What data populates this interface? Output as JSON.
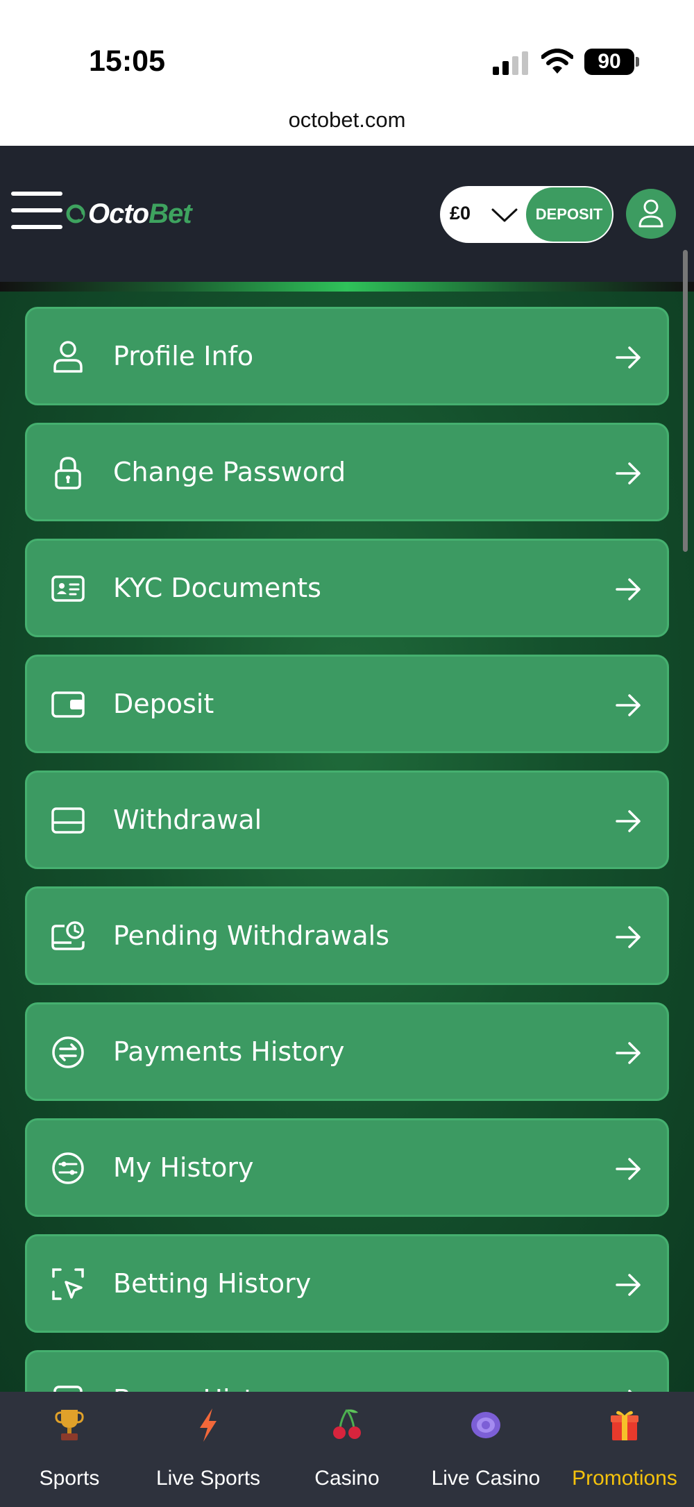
{
  "status_bar": {
    "time": "15:05",
    "battery": "90"
  },
  "browser": {
    "url": "octobet.com"
  },
  "header": {
    "logo_part1": "Octo",
    "logo_part2": "Bet",
    "balance": "£0",
    "deposit_label": "DEPOSIT"
  },
  "menu": {
    "items": [
      {
        "label": "Profile Info",
        "icon": "user-icon"
      },
      {
        "label": "Change Password",
        "icon": "lock-icon"
      },
      {
        "label": "KYC Documents",
        "icon": "id-card-icon"
      },
      {
        "label": "Deposit",
        "icon": "wallet-icon"
      },
      {
        "label": "Withdrawal",
        "icon": "card-icon"
      },
      {
        "label": "Pending Withdrawals",
        "icon": "pending-clock-icon"
      },
      {
        "label": "Payments History",
        "icon": "exchange-icon"
      },
      {
        "label": "My History",
        "icon": "sliders-icon"
      },
      {
        "label": "Betting History",
        "icon": "select-cursor-icon"
      },
      {
        "label": "Bonus History",
        "icon": "bonus-icon"
      }
    ]
  },
  "bottom_nav": {
    "items": [
      {
        "label": "Sports",
        "icon": "trophy-icon"
      },
      {
        "label": "Live Sports",
        "icon": "lightning-icon"
      },
      {
        "label": "Casino",
        "icon": "cherries-icon"
      },
      {
        "label": "Live Casino",
        "icon": "chip-icon"
      },
      {
        "label": "Promotions",
        "icon": "gift-icon"
      }
    ],
    "active": "Promotions"
  },
  "colors": {
    "header_bg": "#20242e",
    "accent_green": "#3d9c61",
    "menu_item_bg": "#3c9a62",
    "nav_bg": "#2e323d",
    "active_nav": "#f4c20d"
  }
}
